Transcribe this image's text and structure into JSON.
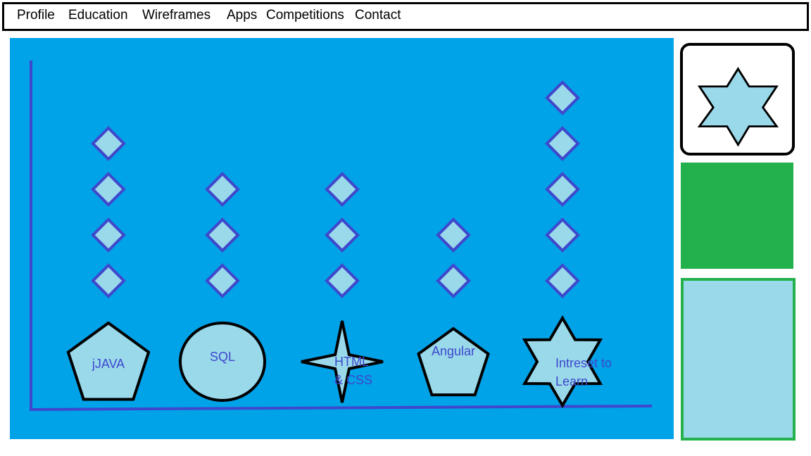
{
  "nav": {
    "items": [
      {
        "id": "profile",
        "label": "Profile"
      },
      {
        "id": "education",
        "label": "Education"
      },
      {
        "id": "wireframes",
        "label": "Wireframes"
      },
      {
        "id": "apps",
        "label": "Apps"
      },
      {
        "id": "competitions",
        "label": "Competitions"
      },
      {
        "id": "contact",
        "label": "Contact"
      }
    ]
  },
  "skills": {
    "items": [
      {
        "label": "jJAVA",
        "shape": "pentagon",
        "level": 4
      },
      {
        "label": "SQL",
        "shape": "circle",
        "level": 3
      },
      {
        "label": "HTML\n& CSS",
        "shape": "four-point-star",
        "level": 3
      },
      {
        "label": "Angular",
        "shape": "pentagon",
        "level": 2
      },
      {
        "label": "Intreset to\nLearn",
        "shape": "six-point-star",
        "level": 5
      }
    ]
  },
  "colors": {
    "panel": "#00a2e8",
    "shape_fill": "#99d9ea",
    "diamond_stroke": "#3f48cc",
    "axis": "#3f48cc",
    "label": "#3f48cc",
    "green": "#22b14c"
  },
  "sidebar": {
    "top_card_icon": "six-point-star-icon"
  }
}
